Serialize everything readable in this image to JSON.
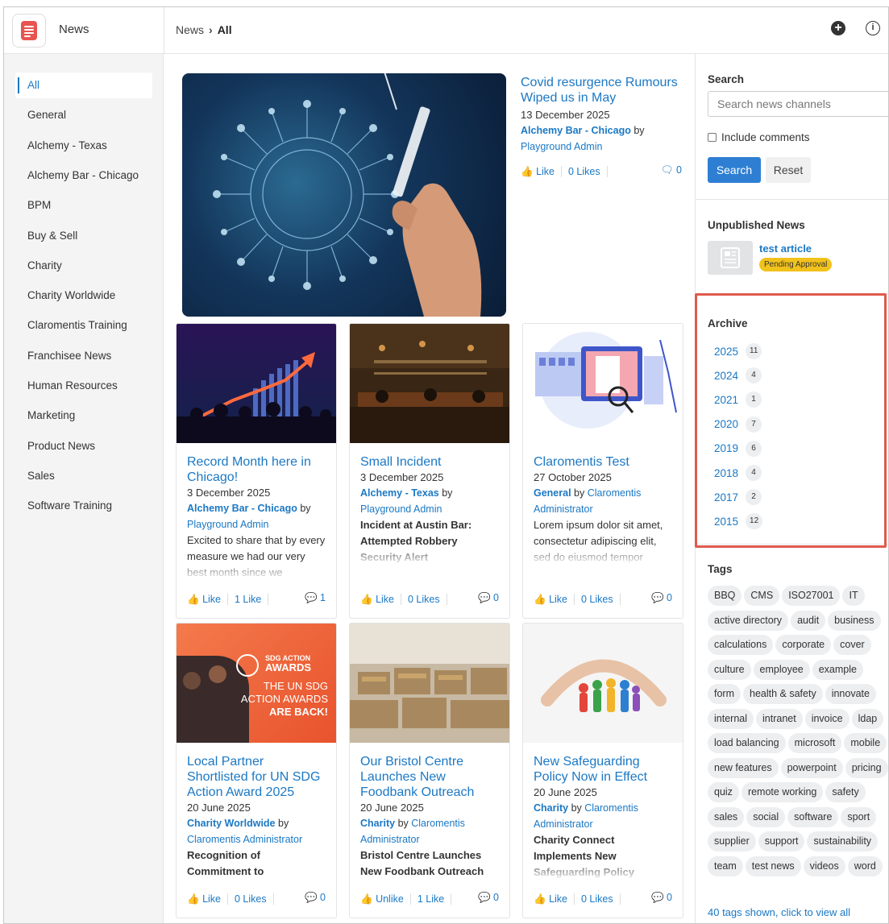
{
  "app": {
    "name": "News"
  },
  "breadcrumb": {
    "parent": "News",
    "current": "All"
  },
  "sidebar": {
    "items": [
      "All",
      "General",
      "Alchemy - Texas",
      "Alchemy Bar - Chicago",
      "BPM",
      "Buy & Sell",
      "Charity",
      "Charity Worldwide",
      "Claromentis Training",
      "Franchisee News",
      "Human Resources",
      "Marketing",
      "Product News",
      "Sales",
      "Software Training"
    ]
  },
  "featured": {
    "title": "Covid resurgence Rumours Wiped us in May",
    "date": "13 December 2025",
    "channel": "Alchemy Bar - Chicago",
    "by": "by",
    "author": "Playground Admin",
    "like_label": "Like",
    "likes": "0 Likes",
    "comments": "0"
  },
  "cards": [
    {
      "title": "Record Month here in Chicago!",
      "date": "3 December 2025",
      "channel": "Alchemy Bar - Chicago",
      "by": "by",
      "author": "Playground Admin",
      "excerpt": "Excited to share that by every measure we had our very best month since we",
      "like_label": "Like",
      "likes": "1 Like",
      "comments": "1"
    },
    {
      "title": "Small Incident",
      "date": "3 December 2025",
      "channel": "Alchemy - Texas",
      "by": "by",
      "author": "Playground Admin",
      "excerpt": "Incident at Austin Bar: Attempted Robbery Security Alert",
      "like_label": "Like",
      "likes": "0 Likes",
      "comments": "0"
    },
    {
      "title": "Claromentis Test",
      "date": "27 October 2025",
      "channel": "General",
      "by": "by",
      "author": "Claromentis Administrator",
      "excerpt": "Lorem ipsum dolor sit amet, consectetur adipiscing elit, sed do eiusmod tempor incididunt ut labore et",
      "like_label": "Like",
      "likes": "0 Likes",
      "comments": "0"
    },
    {
      "title": "Local Partner Shortlisted for UN SDG Action Award 2025",
      "date": "20 June 2025",
      "channel": "Charity Worldwide",
      "by": "by",
      "author": "Claromentis Administrator",
      "excerpt": "Recognition of Commitment to",
      "like_label": "Like",
      "likes": "0 Likes",
      "comments": "0",
      "img_text": {
        "badge1": "SDG ACTION",
        "badge2": "AWARDS",
        "l1": "THE UN SDG",
        "l2": "ACTION AWARDS",
        "l3": "ARE BACK!"
      }
    },
    {
      "title": "Our Bristol Centre Launches New Foodbank Outreach",
      "date": "20 June 2025",
      "channel": "Charity",
      "by": "by",
      "author": "Claromentis Administrator",
      "excerpt": "Bristol Centre Launches New Foodbank Outreach",
      "like_label": "Unlike",
      "likes": "1 Like",
      "comments": "0"
    },
    {
      "title": "New Safeguarding Policy Now in Effect",
      "date": "20 June 2025",
      "channel": "Charity",
      "by": "by",
      "author": "Claromentis Administrator",
      "excerpt": "Charity Connect Implements New Safeguarding Policy",
      "like_label": "Like",
      "likes": "0 Likes",
      "comments": "0"
    }
  ],
  "search": {
    "heading": "Search",
    "placeholder": "Search news channels",
    "include_comments": "Include comments",
    "search_button": "Search",
    "reset_button": "Reset"
  },
  "unpublished": {
    "heading": "Unpublished News",
    "title": "test article",
    "status": "Pending Approval"
  },
  "archive": {
    "heading": "Archive",
    "years": [
      {
        "year": "2025",
        "count": "11"
      },
      {
        "year": "2024",
        "count": "4"
      },
      {
        "year": "2021",
        "count": "1"
      },
      {
        "year": "2020",
        "count": "7"
      },
      {
        "year": "2019",
        "count": "6"
      },
      {
        "year": "2018",
        "count": "4"
      },
      {
        "year": "2017",
        "count": "2"
      },
      {
        "year": "2015",
        "count": "12"
      }
    ]
  },
  "tags": {
    "heading": "Tags",
    "items": [
      "BBQ",
      "CMS",
      "ISO27001",
      "IT",
      "active directory",
      "audit",
      "business",
      "calculations",
      "corporate",
      "cover",
      "culture",
      "employee",
      "example",
      "form",
      "health & safety",
      "innovate",
      "internal",
      "intranet",
      "invoice",
      "ldap",
      "load balancing",
      "microsoft",
      "mobile",
      "new features",
      "powerpoint",
      "pricing",
      "quiz",
      "remote working",
      "safety",
      "sales",
      "social",
      "software",
      "sport",
      "supplier",
      "support",
      "sustainability",
      "team",
      "test news",
      "videos",
      "word"
    ],
    "footer": "40 tags shown, click to view all"
  },
  "colors": {
    "accent": "#1b78c4",
    "highlight": "#e05a4d",
    "pending": "#f2c21c"
  }
}
